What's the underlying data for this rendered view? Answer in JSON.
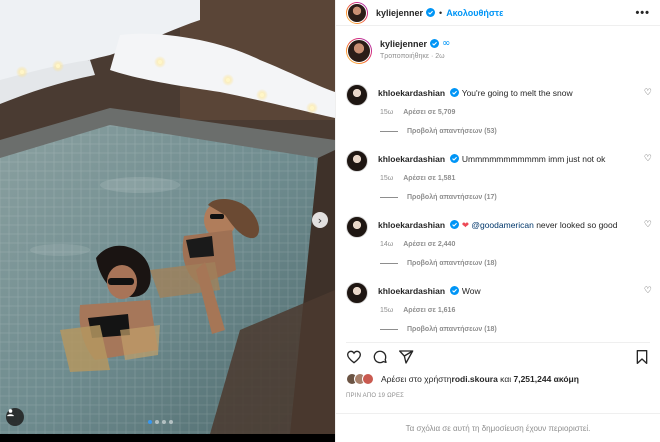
{
  "post": {
    "author": "kyliejenner",
    "follow_label": "Ακολουθήστε",
    "more_label": "•••",
    "caption_edited": "Τροποποιήθηκε · 2ω",
    "image_dots": 4,
    "active_dot": 0
  },
  "comments": [
    {
      "user": "khloekardashian",
      "text": "You're going to melt the snow",
      "time": "15ω",
      "likes": "Αρέσει σε 5,709",
      "replies": "Προβολή απαντήσεων (53)"
    },
    {
      "user": "khloekardashian",
      "text": "Ummmmmmmmmmm imm just not ok",
      "time": "15ω",
      "likes": "Αρέσει σε 1,581",
      "replies": "Προβολή απαντήσεων (17)"
    },
    {
      "user": "khloekardashian",
      "emoji": "❤",
      "mention": "@goodamerican",
      "text_after": " never looked so good",
      "time": "14ω",
      "likes": "Αρέσει σε 2,440",
      "replies": "Προβολή απαντήσεων (18)"
    },
    {
      "user": "khloekardashian",
      "text": "Wow",
      "time": "15ω",
      "likes": "Αρέσει σε 1,616",
      "replies": "Προβολή απαντήσεων (18)"
    }
  ],
  "likes_bar": {
    "prefix": "Αρέσει στο χρήστη ",
    "user": "rodi.skoura",
    "middle": " και ",
    "count": "7,251,244 ακόμη"
  },
  "time_ago": "ΠΡΙΝ ΑΠΟ 19 ΩΡΕΣ",
  "restricted_notice": "Τα σχόλια σε αυτή τη δημοσίευση έχουν περιοριστεί.",
  "colors": {
    "accent": "#0095f6",
    "verified": "#0095f6",
    "heart_red": "#ed4956"
  },
  "icons": [
    "heart-icon",
    "comment-icon",
    "share-icon",
    "bookmark-icon",
    "verified-icon",
    "infinity-icon",
    "chevron-right-icon",
    "tag-user-icon"
  ]
}
